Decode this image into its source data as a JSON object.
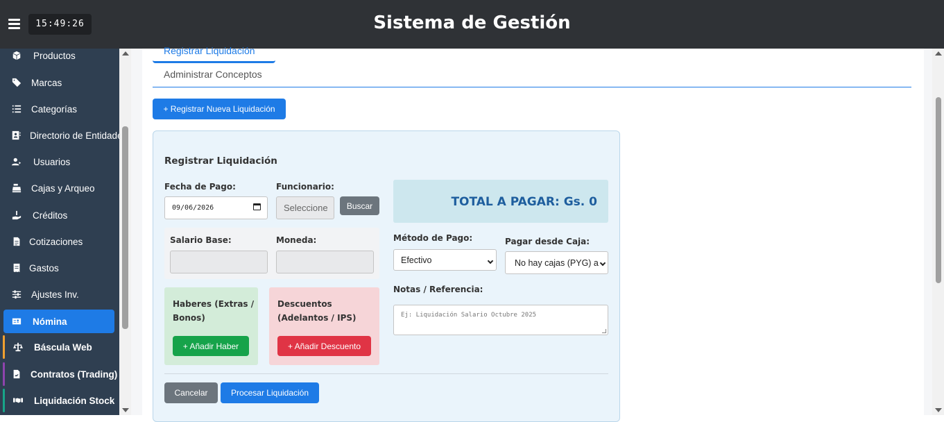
{
  "header": {
    "clock": "15:49:26",
    "title": "Sistema de Gestión"
  },
  "sidebar": {
    "items": [
      {
        "label": "Productos",
        "icon": "box-icon"
      },
      {
        "label": "Marcas",
        "icon": "tags-icon"
      },
      {
        "label": "Categorías",
        "icon": "list-icon"
      },
      {
        "label": "Directorio de Entidades",
        "icon": "address-book-icon"
      },
      {
        "label": "Usuarios",
        "icon": "users-icon"
      },
      {
        "label": "Cajas y Arqueo",
        "icon": "cash-register-icon"
      },
      {
        "label": "Créditos",
        "icon": "hand-holding-dollar-icon"
      },
      {
        "label": "Cotizaciones",
        "icon": "file-invoice-icon"
      },
      {
        "label": "Gastos",
        "icon": "receipt-icon"
      },
      {
        "label": "Ajustes Inv.",
        "icon": "sliders-icon"
      },
      {
        "label": "Nómina",
        "icon": "id-card-icon",
        "active": true
      },
      {
        "label": "Báscula Web",
        "icon": "scale-icon",
        "accent": "#f0a030"
      },
      {
        "label": "Contratos (Trading)",
        "icon": "file-contract-icon",
        "accent": "#8e44ad"
      },
      {
        "label": "Liquidación Stock",
        "icon": "handshake-icon",
        "accent": "#17a589"
      }
    ]
  },
  "tabs": {
    "active": "Registrar Liquidación",
    "second": "Administrar Conceptos"
  },
  "new_button": "+ Registrar Nueva Liquidación",
  "form": {
    "title": "Registrar Liquidación",
    "fecha_label": "Fecha de Pago:",
    "fecha_value": "09/06/2026",
    "funcionario_label": "Funcionario:",
    "funcionario_placeholder": "Seleccione",
    "buscar": "Buscar",
    "total": "TOTAL A PAGAR: Gs. 0",
    "salario_label": "Salario Base:",
    "moneda_label": "Moneda:",
    "metodo_label": "Método de Pago:",
    "metodo_value": "Efectivo",
    "caja_label": "Pagar desde Caja:",
    "caja_value": "No hay cajas (PYG) a",
    "haberes_title_1": "Haberes (Extras /",
    "haberes_title_2": "Bonos)",
    "haberes_button": "+ Añadir Haber",
    "descuentos_title_1": "Descuentos",
    "descuentos_title_2": "(Adelantos / IPS)",
    "descuentos_button": "+ Añadir Descuento",
    "notas_label": "Notas / Referencia:",
    "notas_placeholder": "Ej: Liquidación Salario Octubre 2025",
    "cancel": "Cancelar",
    "process": "Procesar Liquidación"
  },
  "colors": {
    "primary": "#1e7be6",
    "success": "#16a34a",
    "danger": "#e03445",
    "secondary": "#6c757d",
    "sidebar": "#2f3f51",
    "topbar": "#2f3236"
  }
}
